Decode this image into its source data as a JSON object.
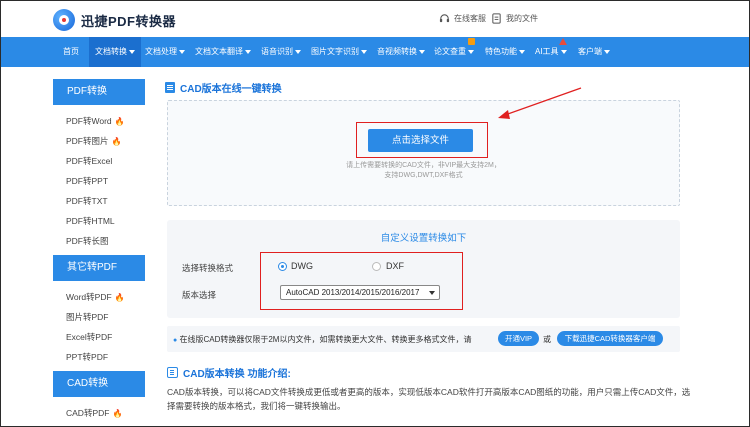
{
  "header": {
    "logo_text": "迅捷PDF转换器",
    "service_label": "在线客服",
    "files_label": "我的文件"
  },
  "nav": {
    "items": [
      {
        "label": "首页",
        "caret": false
      },
      {
        "label": "文档转换",
        "caret": true
      },
      {
        "label": "文档处理",
        "caret": true
      },
      {
        "label": "文档文本翻译",
        "caret": true
      },
      {
        "label": "语音识别",
        "caret": true
      },
      {
        "label": "图片文字识别",
        "caret": true
      },
      {
        "label": "音视频转换",
        "caret": true
      },
      {
        "label": "论文查重",
        "caret": true
      },
      {
        "label": "特色功能",
        "caret": true
      },
      {
        "label": "AI工具",
        "caret": true
      },
      {
        "label": "客户端",
        "caret": true
      }
    ],
    "active_index": 1
  },
  "sidebar": {
    "groups": [
      {
        "title": "PDF转换",
        "items": [
          {
            "label": "PDF转Word",
            "hot": true
          },
          {
            "label": "PDF转图片",
            "hot": true
          },
          {
            "label": "PDF转Excel",
            "hot": false
          },
          {
            "label": "PDF转PPT",
            "hot": false
          },
          {
            "label": "PDF转TXT",
            "hot": false
          },
          {
            "label": "PDF转HTML",
            "hot": false
          },
          {
            "label": "PDF转长图",
            "hot": false
          }
        ]
      },
      {
        "title": "其它转PDF",
        "items": [
          {
            "label": "Word转PDF",
            "hot": true
          },
          {
            "label": "图片转PDF",
            "hot": false
          },
          {
            "label": "Excel转PDF",
            "hot": false
          },
          {
            "label": "PPT转PDF",
            "hot": false
          }
        ]
      },
      {
        "title": "CAD转换",
        "items": [
          {
            "label": "CAD转PDF",
            "hot": true
          }
        ]
      }
    ]
  },
  "main": {
    "title": "CAD版本在线一键转换",
    "upload_button": "点击选择文件",
    "upload_hint_1": "请上传需要转换的CAD文件，非VIP最大支持2M，",
    "upload_hint_2": "支持DWG,DWT,DXF格式",
    "settings_title": "自定义设置转换如下",
    "format_label": "选择转换格式",
    "format_options": [
      "DWG",
      "DXF"
    ],
    "format_selected": "DWG",
    "version_label": "版本选择",
    "version_selected": "AutoCAD 2013/2014/2015/2016/2017",
    "notice_text": "在线版CAD转换器仅限于2M以内文件，如需转换更大文件、转换更多格式文件，请",
    "vip_button": "开通VIP",
    "notice_or": "或",
    "download_button": "下载迅捷CAD转换器客户端",
    "intro_title": "CAD版本转换 功能介绍:",
    "intro_text": "CAD版本转换，可以将CAD文件转换成更低或者更高的版本，实现低版本CAD软件打开高版本CAD图纸的功能，用户只需上传CAD文件，选择需要转换的版本格式，我们将一键转换输出。"
  },
  "colors": {
    "primary": "#2b8ae6",
    "nav_active": "#1b6fcf",
    "annotation_red": "#e02020",
    "hot": "#ff6a00"
  }
}
